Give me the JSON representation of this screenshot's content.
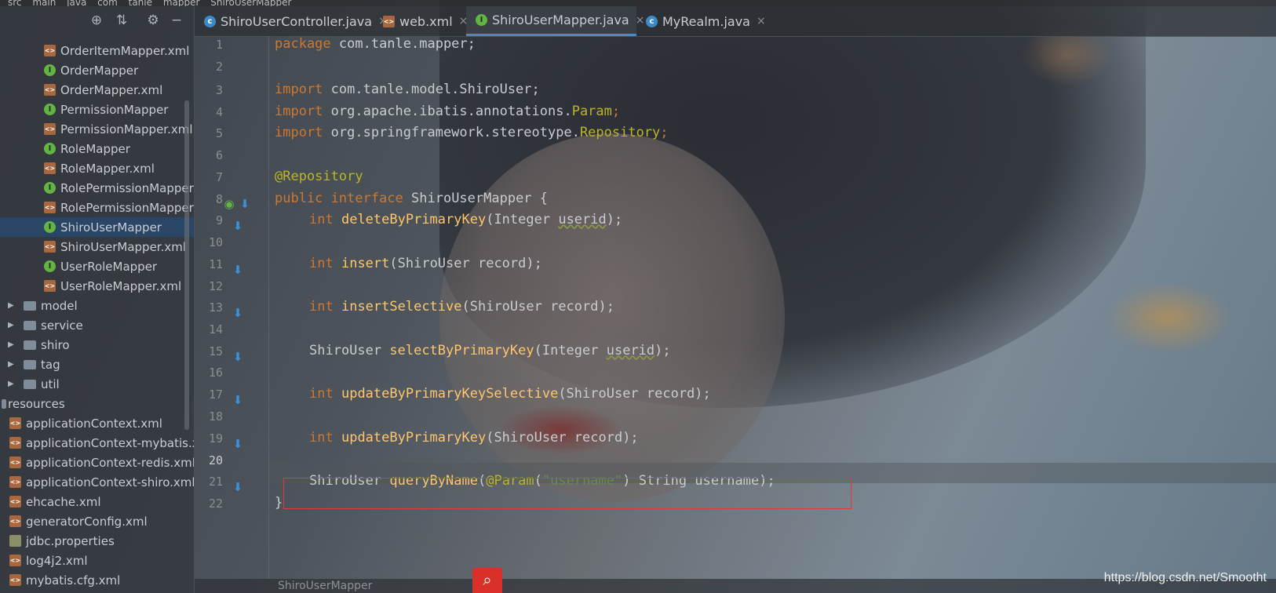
{
  "breadcrumb": [
    "src",
    "main",
    "java",
    "com",
    "tanle",
    "mapper",
    "ShiroUserMapper"
  ],
  "project": {
    "toolbar": [
      "target-icon",
      "collapse-icon",
      "gear-icon",
      "minimize-icon"
    ],
    "files": [
      {
        "label": "OrderItemMapper.xml",
        "type": "xml",
        "indent": 1
      },
      {
        "label": "OrderMapper",
        "type": "interface",
        "indent": 1
      },
      {
        "label": "OrderMapper.xml",
        "type": "xml",
        "indent": 1
      },
      {
        "label": "PermissionMapper",
        "type": "interface",
        "indent": 1
      },
      {
        "label": "PermissionMapper.xml",
        "type": "xml",
        "indent": 1
      },
      {
        "label": "RoleMapper",
        "type": "interface",
        "indent": 1
      },
      {
        "label": "RoleMapper.xml",
        "type": "xml",
        "indent": 1
      },
      {
        "label": "RolePermissionMapper",
        "type": "interface",
        "indent": 1
      },
      {
        "label": "RolePermissionMapper",
        "type": "xml",
        "indent": 1
      },
      {
        "label": "ShiroUserMapper",
        "type": "interface",
        "indent": 1,
        "selected": true
      },
      {
        "label": "ShiroUserMapper.xml",
        "type": "xml",
        "indent": 1
      },
      {
        "label": "UserRoleMapper",
        "type": "interface",
        "indent": 1
      },
      {
        "label": "UserRoleMapper.xml",
        "type": "xml",
        "indent": 1
      },
      {
        "label": "model",
        "type": "folder",
        "indent": 0
      },
      {
        "label": "service",
        "type": "folder",
        "indent": 0
      },
      {
        "label": "shiro",
        "type": "folder",
        "indent": 0
      },
      {
        "label": "tag",
        "type": "folder",
        "indent": 0
      },
      {
        "label": "util",
        "type": "folder",
        "indent": 0
      },
      {
        "label": "resources",
        "type": "root",
        "indent": -1
      },
      {
        "label": "applicationContext.xml",
        "type": "xml",
        "indent": -0.5
      },
      {
        "label": "applicationContext-mybatis.x",
        "type": "xml",
        "indent": -0.5
      },
      {
        "label": "applicationContext-redis.xml",
        "type": "xml",
        "indent": -0.5
      },
      {
        "label": "applicationContext-shiro.xml",
        "type": "xml",
        "indent": -0.5
      },
      {
        "label": "ehcache.xml",
        "type": "xml",
        "indent": -0.5
      },
      {
        "label": "generatorConfig.xml",
        "type": "xml",
        "indent": -0.5
      },
      {
        "label": "jdbc.properties",
        "type": "props",
        "indent": -0.5
      },
      {
        "label": "log4j2.xml",
        "type": "xml",
        "indent": -0.5
      },
      {
        "label": "mybatis.cfg.xml",
        "type": "xml",
        "indent": -0.5
      }
    ]
  },
  "tabs": [
    {
      "label": "ShiroUserController.java",
      "icon": "class",
      "close": "×"
    },
    {
      "label": "web.xml",
      "icon": "xml",
      "close": "×"
    },
    {
      "label": "ShiroUserMapper.java",
      "icon": "interface",
      "close": "×",
      "active": true
    },
    {
      "label": "MyRealm.java",
      "icon": "class",
      "close": "×"
    }
  ],
  "line_numbers": [
    "1",
    "2",
    "3",
    "4",
    "5",
    "6",
    "7",
    "8",
    "9",
    "10",
    "11",
    "12",
    "13",
    "14",
    "15",
    "16",
    "17",
    "18",
    "19",
    "20",
    "21",
    "22"
  ],
  "code": {
    "l1_kw": "package",
    "l1_rest": " com.tanle.mapper;",
    "l3_kw": "import",
    "l3_rest": " com.tanle.model.ShiroUser;",
    "l4_kw": "import",
    "l4_rest": " org.apache.ibatis.annotations.",
    "l4_ann": "Param",
    "l4_end": ";",
    "l5_kw": "import",
    "l5_rest": " org.springframework.stereotype.",
    "l5_ann": "Repository",
    "l5_end": ";",
    "l7_ann": "@Repository",
    "l8_kw1": "public",
    "l8_kw2": " interface",
    "l8_rest": " ShiroUserMapper {",
    "l9_type": "int",
    "l9_fn": "deleteByPrimaryKey",
    "l9_a": "(Integer ",
    "l9_p": "userid",
    "l9_b": ");",
    "l11_type": "int",
    "l11_fn": "insert",
    "l11_a": "(ShiroUser record);",
    "l13_type": "int",
    "l13_fn": "insertSelective",
    "l13_a": "(ShiroUser record);",
    "l15_type": "ShiroUser",
    "l15_fn": "selectByPrimaryKey",
    "l15_a": "(Integer ",
    "l15_p": "userid",
    "l15_b": ");",
    "l17_type": "int",
    "l17_fn": "updateByPrimaryKeySelective",
    "l17_a": "(ShiroUser record);",
    "l19_type": "int",
    "l19_fn": "updateByPrimaryKey",
    "l19_a": "(ShiroUser record);",
    "l21_type": "ShiroUser",
    "l21_fn": "queryByName",
    "l21_a": "(",
    "l21_ann": "@Param",
    "l21_b": "(",
    "l21_str": "\"username\"",
    "l21_c": ") String username);",
    "l22": "}"
  },
  "status": {
    "breadcrumb": "ShiroUserMapper"
  },
  "watermark": "https://blog.csdn.net/Smootht"
}
